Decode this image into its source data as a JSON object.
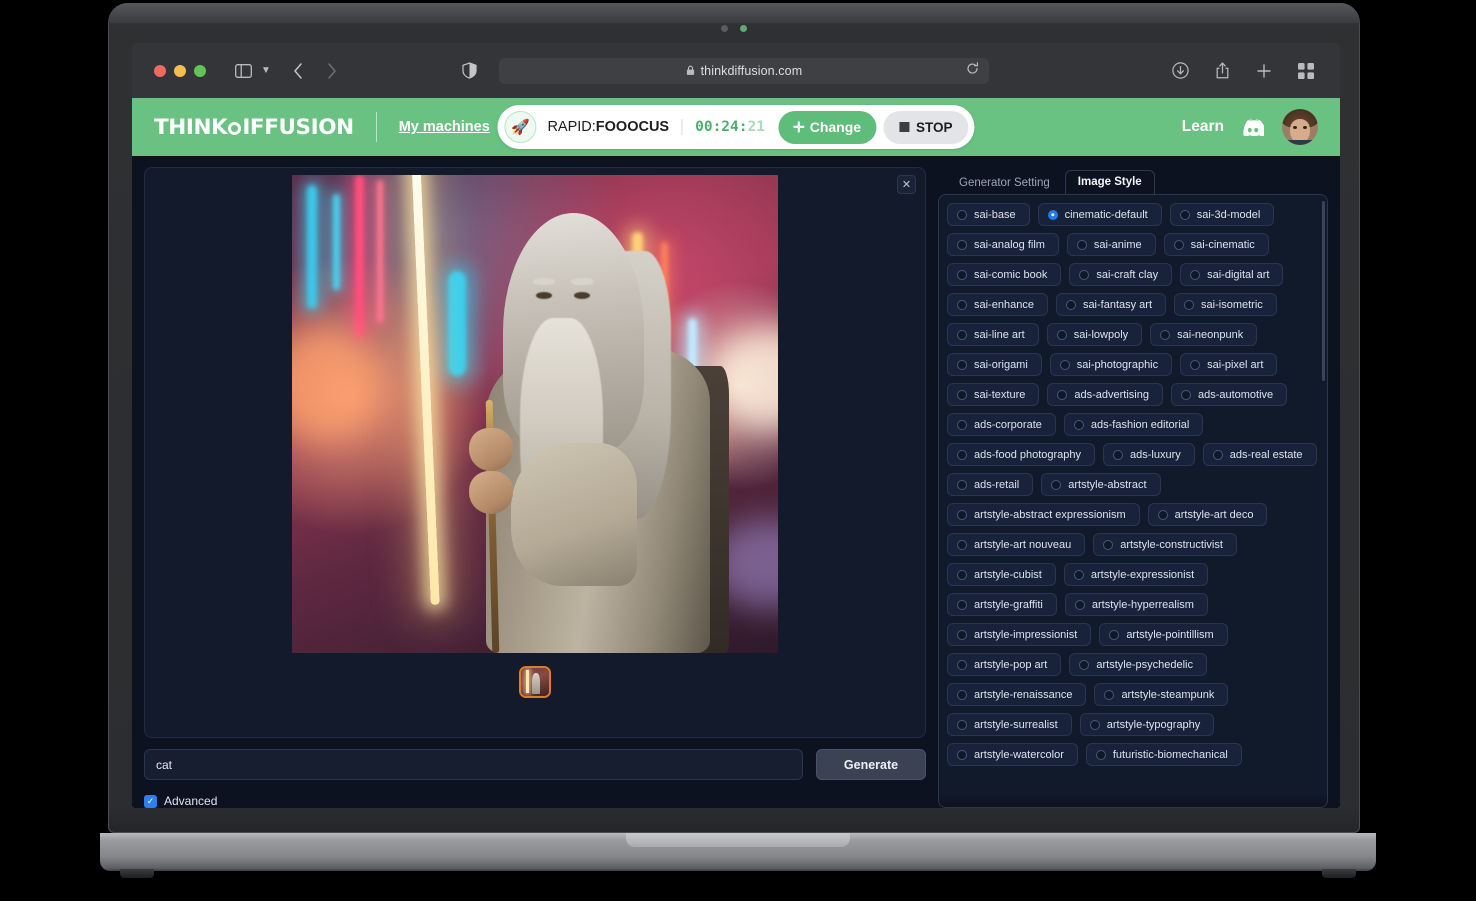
{
  "browser": {
    "url": "thinkdiffusion.com",
    "lock_icon": "lock-icon",
    "reload_icon": "reload-icon",
    "back_icon": "chevron-left-icon",
    "forward_icon": "chevron-right-icon",
    "sidebar_icon": "sidebar-toggle-icon",
    "chevron_icon": "chevron-down-icon",
    "shield_icon": "shield-icon",
    "download_icon": "download-icon",
    "share_icon": "share-icon",
    "newtab_icon": "plus-icon",
    "tabs_overview_icon": "tab-overview-icon"
  },
  "header": {
    "brand": {
      "part1": "THINK",
      "part2": "IFFUSION"
    },
    "my_machines": "My machines",
    "machine": {
      "rocket_icon": "rocket-icon",
      "prefix": "RAPID:",
      "name": "FOOOCUS",
      "timer_hours": "00",
      "timer_minutes": "24",
      "timer_seconds": "21",
      "change_label": "Change",
      "change_icon": "plus-icon",
      "stop_label": "STOP",
      "stop_icon": "stop-square-icon"
    },
    "learn": "Learn",
    "discord_icon": "discord-icon",
    "avatar": "user-avatar",
    "accent_green": "#69c282",
    "pill_green": "#5fbd7b",
    "timer_green": "#4fae6c"
  },
  "workspace": {
    "close_preview_icon": "close-icon",
    "preview_alt": "generated-image-wizard-neon",
    "thumbnail_alt": "generated-image-thumbnail",
    "prompt_value": "cat",
    "prompt_placeholder": "",
    "generate_label": "Generate",
    "advanced_label": "Advanced",
    "advanced_checked": true,
    "check_glyph": "✓"
  },
  "panel": {
    "tabs": [
      {
        "label": "Generator Setting",
        "active": false
      },
      {
        "label": "Image Style",
        "active": true
      }
    ],
    "selected_style": "cinematic-default",
    "selected_accent": "#1f7bf0",
    "styles": [
      "sai-base",
      "cinematic-default",
      "sai-3d-model",
      "sai-analog film",
      "sai-anime",
      "sai-cinematic",
      "sai-comic book",
      "sai-craft clay",
      "sai-digital art",
      "sai-enhance",
      "sai-fantasy art",
      "sai-isometric",
      "sai-line art",
      "sai-lowpoly",
      "sai-neonpunk",
      "sai-origami",
      "sai-photographic",
      "sai-pixel art",
      "sai-texture",
      "ads-advertising",
      "ads-automotive",
      "ads-corporate",
      "ads-fashion editorial",
      "ads-food photography",
      "ads-luxury",
      "ads-real estate",
      "ads-retail",
      "artstyle-abstract",
      "artstyle-abstract expressionism",
      "artstyle-art deco",
      "artstyle-art nouveau",
      "artstyle-constructivist",
      "artstyle-cubist",
      "artstyle-expressionist",
      "artstyle-graffiti",
      "artstyle-hyperrealism",
      "artstyle-impressionist",
      "artstyle-pointillism",
      "artstyle-pop art",
      "artstyle-psychedelic",
      "artstyle-renaissance",
      "artstyle-steampunk",
      "artstyle-surrealist",
      "artstyle-typography",
      "artstyle-watercolor",
      "futuristic-biomechanical"
    ]
  }
}
